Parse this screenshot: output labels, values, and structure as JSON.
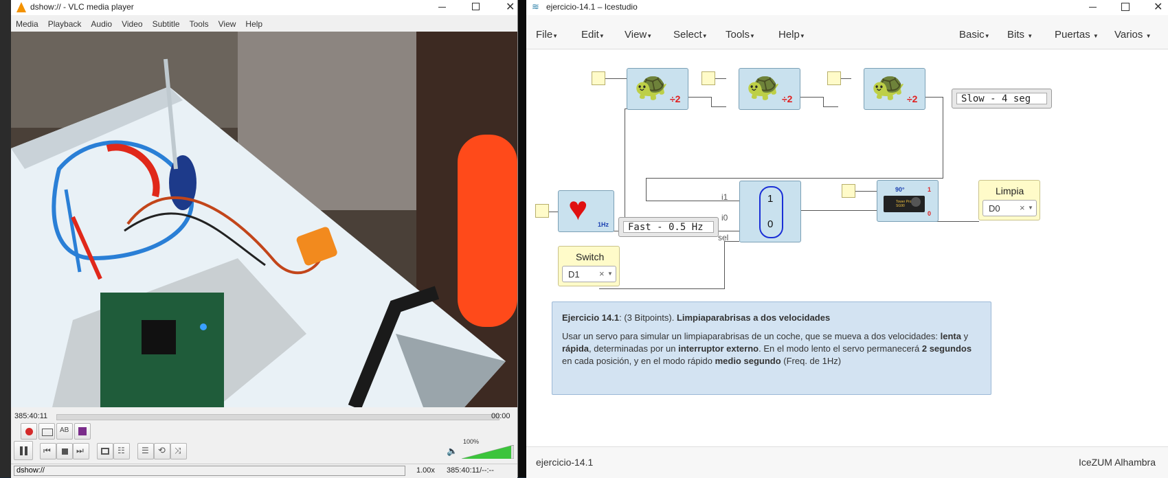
{
  "vlc": {
    "title": "dshow:// - VLC media player",
    "menu": [
      "Media",
      "Playback",
      "Audio",
      "Video",
      "Subtitle",
      "Tools",
      "View",
      "Help"
    ],
    "time_elapsed": "385:40:11",
    "time_total": "00:00",
    "volume": "100%",
    "status_source": "dshow://",
    "status_speed": "1.00x",
    "status_time": "385:40:11/--:--"
  },
  "ice": {
    "title": "ejercicio-14.1 – Icestudio",
    "menu_left": [
      "File",
      "Edit",
      "View",
      "Select",
      "Tools",
      "Help"
    ],
    "menu_right": [
      "Basic",
      "Bits",
      "Puertas",
      "Varios"
    ],
    "comment_slow": "Slow - 4 seg",
    "comment_fast": "Fast - 0.5 Hz",
    "div_label": "÷2",
    "heart_label": "1Hz",
    "mux": {
      "i1": "i1",
      "i0": "i0",
      "sel": "sel",
      "top": "1",
      "bottom": "0"
    },
    "servo": {
      "deg": "90°",
      "one": "1",
      "zero": "0",
      "brand": "Tower Pro SG90"
    },
    "switch_block": {
      "label": "Switch",
      "value": "D1"
    },
    "limpia_block": {
      "label": "Limpia",
      "value": "D0"
    },
    "desc": {
      "title_bold": "Ejercicio 14.1",
      "title_rest": ": (3 Bitpoints). ",
      "title_bold2": "Limpiaparabrisas a dos velocidades",
      "p1": "Usar un servo para simular un limpiaparabrisas de un coche, que se mueva a dos velocidades: ",
      "b1": "lenta",
      "p2": " y ",
      "b2": "rápida",
      "p3": ", determinadas por un ",
      "b3": "interruptor externo",
      "p4": ". En el modo lento el servo permanecerá ",
      "b4": "2 segundos",
      "p5": " en cada posición, y en el modo rápido ",
      "b5": "medio segundo",
      "p6": " (Freq. de 1Hz)"
    },
    "footer_left": "ejercicio-14.1",
    "footer_right": "IceZUM Alhambra"
  }
}
